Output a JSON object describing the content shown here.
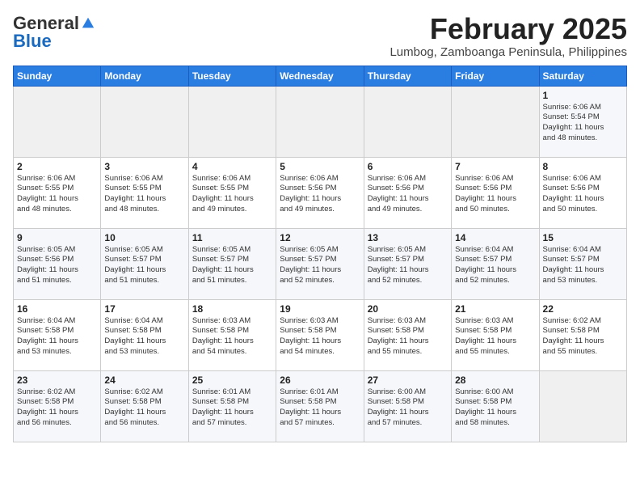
{
  "header": {
    "logo_general": "General",
    "logo_blue": "Blue",
    "month_title": "February 2025",
    "location": "Lumbog, Zamboanga Peninsula, Philippines"
  },
  "weekdays": [
    "Sunday",
    "Monday",
    "Tuesday",
    "Wednesday",
    "Thursday",
    "Friday",
    "Saturday"
  ],
  "weeks": [
    [
      {
        "day": "",
        "info": ""
      },
      {
        "day": "",
        "info": ""
      },
      {
        "day": "",
        "info": ""
      },
      {
        "day": "",
        "info": ""
      },
      {
        "day": "",
        "info": ""
      },
      {
        "day": "",
        "info": ""
      },
      {
        "day": "1",
        "info": "Sunrise: 6:06 AM\nSunset: 5:54 PM\nDaylight: 11 hours\nand 48 minutes."
      }
    ],
    [
      {
        "day": "2",
        "info": "Sunrise: 6:06 AM\nSunset: 5:55 PM\nDaylight: 11 hours\nand 48 minutes."
      },
      {
        "day": "3",
        "info": "Sunrise: 6:06 AM\nSunset: 5:55 PM\nDaylight: 11 hours\nand 48 minutes."
      },
      {
        "day": "4",
        "info": "Sunrise: 6:06 AM\nSunset: 5:55 PM\nDaylight: 11 hours\nand 49 minutes."
      },
      {
        "day": "5",
        "info": "Sunrise: 6:06 AM\nSunset: 5:56 PM\nDaylight: 11 hours\nand 49 minutes."
      },
      {
        "day": "6",
        "info": "Sunrise: 6:06 AM\nSunset: 5:56 PM\nDaylight: 11 hours\nand 49 minutes."
      },
      {
        "day": "7",
        "info": "Sunrise: 6:06 AM\nSunset: 5:56 PM\nDaylight: 11 hours\nand 50 minutes."
      },
      {
        "day": "8",
        "info": "Sunrise: 6:06 AM\nSunset: 5:56 PM\nDaylight: 11 hours\nand 50 minutes."
      }
    ],
    [
      {
        "day": "9",
        "info": "Sunrise: 6:05 AM\nSunset: 5:56 PM\nDaylight: 11 hours\nand 51 minutes."
      },
      {
        "day": "10",
        "info": "Sunrise: 6:05 AM\nSunset: 5:57 PM\nDaylight: 11 hours\nand 51 minutes."
      },
      {
        "day": "11",
        "info": "Sunrise: 6:05 AM\nSunset: 5:57 PM\nDaylight: 11 hours\nand 51 minutes."
      },
      {
        "day": "12",
        "info": "Sunrise: 6:05 AM\nSunset: 5:57 PM\nDaylight: 11 hours\nand 52 minutes."
      },
      {
        "day": "13",
        "info": "Sunrise: 6:05 AM\nSunset: 5:57 PM\nDaylight: 11 hours\nand 52 minutes."
      },
      {
        "day": "14",
        "info": "Sunrise: 6:04 AM\nSunset: 5:57 PM\nDaylight: 11 hours\nand 52 minutes."
      },
      {
        "day": "15",
        "info": "Sunrise: 6:04 AM\nSunset: 5:57 PM\nDaylight: 11 hours\nand 53 minutes."
      }
    ],
    [
      {
        "day": "16",
        "info": "Sunrise: 6:04 AM\nSunset: 5:58 PM\nDaylight: 11 hours\nand 53 minutes."
      },
      {
        "day": "17",
        "info": "Sunrise: 6:04 AM\nSunset: 5:58 PM\nDaylight: 11 hours\nand 53 minutes."
      },
      {
        "day": "18",
        "info": "Sunrise: 6:03 AM\nSunset: 5:58 PM\nDaylight: 11 hours\nand 54 minutes."
      },
      {
        "day": "19",
        "info": "Sunrise: 6:03 AM\nSunset: 5:58 PM\nDaylight: 11 hours\nand 54 minutes."
      },
      {
        "day": "20",
        "info": "Sunrise: 6:03 AM\nSunset: 5:58 PM\nDaylight: 11 hours\nand 55 minutes."
      },
      {
        "day": "21",
        "info": "Sunrise: 6:03 AM\nSunset: 5:58 PM\nDaylight: 11 hours\nand 55 minutes."
      },
      {
        "day": "22",
        "info": "Sunrise: 6:02 AM\nSunset: 5:58 PM\nDaylight: 11 hours\nand 55 minutes."
      }
    ],
    [
      {
        "day": "23",
        "info": "Sunrise: 6:02 AM\nSunset: 5:58 PM\nDaylight: 11 hours\nand 56 minutes."
      },
      {
        "day": "24",
        "info": "Sunrise: 6:02 AM\nSunset: 5:58 PM\nDaylight: 11 hours\nand 56 minutes."
      },
      {
        "day": "25",
        "info": "Sunrise: 6:01 AM\nSunset: 5:58 PM\nDaylight: 11 hours\nand 57 minutes."
      },
      {
        "day": "26",
        "info": "Sunrise: 6:01 AM\nSunset: 5:58 PM\nDaylight: 11 hours\nand 57 minutes."
      },
      {
        "day": "27",
        "info": "Sunrise: 6:00 AM\nSunset: 5:58 PM\nDaylight: 11 hours\nand 57 minutes."
      },
      {
        "day": "28",
        "info": "Sunrise: 6:00 AM\nSunset: 5:58 PM\nDaylight: 11 hours\nand 58 minutes."
      },
      {
        "day": "",
        "info": ""
      }
    ]
  ]
}
